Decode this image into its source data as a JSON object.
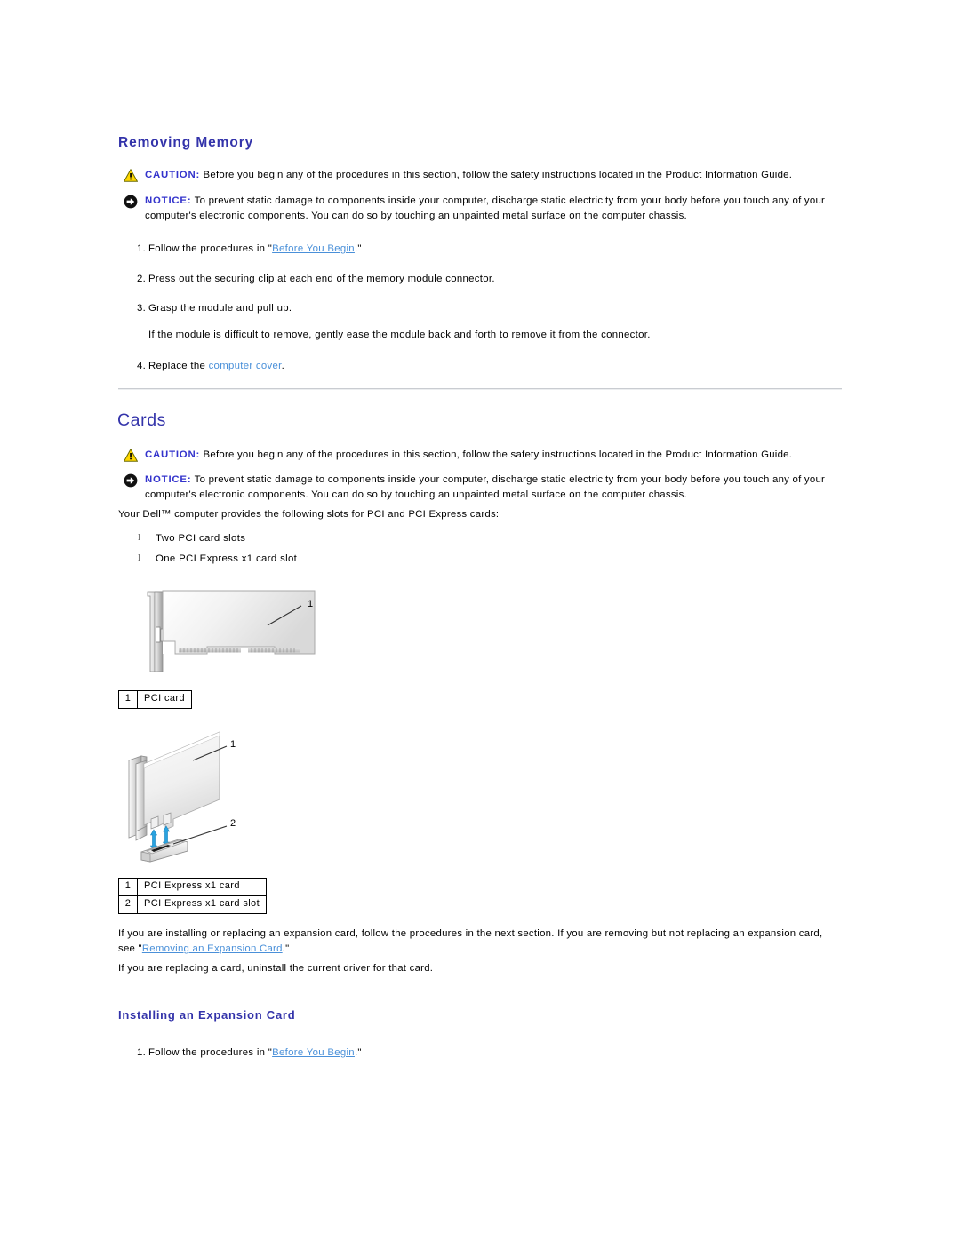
{
  "document": {
    "title": "Removing Memory",
    "link_color": "#4a90d9",
    "heading_color": "#3333aa"
  },
  "sections": {
    "removing_memory": {
      "heading": "Removing Memory",
      "caution": {
        "label": "CAUTION:",
        "text": " Before you begin any of the procedures in this section, follow the safety instructions located in the Product Information Guide."
      },
      "notice": {
        "label": "NOTICE:",
        "text": " To prevent static damage to components inside your computer, discharge static electricity from your body before you touch any of your computer's electronic components. You can do so by touching an unpainted metal surface on the computer chassis."
      },
      "steps": [
        {
          "num": "1.",
          "pre": "Follow the procedures in \"",
          "link": "Before You Begin",
          "post": ".\""
        },
        {
          "num": "2.",
          "pre": "Press out the securing clip at each end of the memory module connector.",
          "link": "",
          "post": ""
        },
        {
          "num": "3.",
          "pre": "Grasp the module and pull up.",
          "link": "",
          "post": ""
        },
        {
          "num": "4.",
          "pre": "Replace the ",
          "link": "computer cover",
          "post": "."
        }
      ],
      "substep_after_3": "If the module is difficult to remove, gently ease the module back and forth to remove it from the connector."
    },
    "cards": {
      "heading": "Cards",
      "caution": {
        "label": "CAUTION:",
        "text": " Before you begin any of the procedures in this section, follow the safety instructions located in the Product Information Guide."
      },
      "notice": {
        "label": "NOTICE:",
        "text": " To prevent static damage to components inside your computer, discharge static electricity from your body before you touch any of your computer's electronic components. You can do so by touching an unpainted metal surface on the computer chassis."
      },
      "intro": "Your Dell™ computer provides the following slots for PCI and PCI Express cards:",
      "bullets": [
        "Two PCI card slots",
        "One PCI Express x1 card slot"
      ],
      "figure_pci": {
        "callout_1": "1",
        "legend": [
          {
            "num": "1",
            "label": "PCI card"
          }
        ]
      },
      "figure_pcie": {
        "callout_1": "1",
        "callout_2": "2",
        "legend": [
          {
            "num": "1",
            "label": "PCI Express x1 card"
          },
          {
            "num": "2",
            "label": "PCI Express x1 card slot"
          }
        ]
      },
      "para_expansion": {
        "pre": "If you are installing or replacing an expansion card, follow the procedures in the next section. If you are removing but not replacing an expansion card, see \"",
        "link": "Removing an Expansion Card",
        "post": ".\""
      },
      "para_driver": "If you are replacing a card, uninstall the current driver for that card."
    },
    "installing_expansion_card": {
      "heading": "Installing an Expansion Card",
      "steps": [
        {
          "num": "1.",
          "pre": "Follow the procedures in \"",
          "link": "Before You Begin",
          "post": ".\""
        }
      ]
    }
  }
}
